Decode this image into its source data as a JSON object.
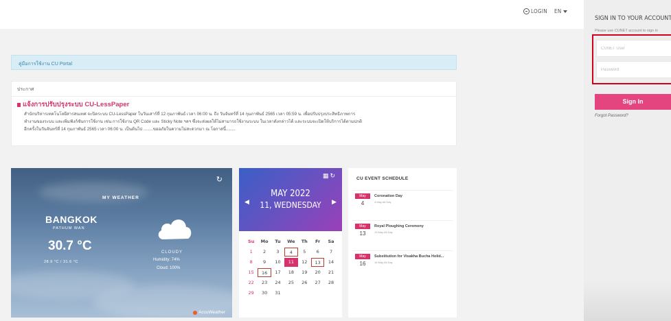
{
  "topnav": {
    "login": "LOGIN",
    "lang": "EN"
  },
  "manual_link": "คู่มือการใช้งาน CU Portal",
  "announcement": {
    "heading": "ประกาศ",
    "title": "แจ้งการปรับปรุงระบบ CU-LessPaper",
    "lines": [
      "สำนักบริหารเทคโนโลยีสารสนเทศ จะปิดระบบ CU-LessPaper ในวันเสาร์ที่ 12 กุมภาพันธ์ เวลา 06:00 น. ถึง วันจันทร์ที่ 14 กุมภาพันธ์ 2565 เวลา 05:59 น. เพื่อปรับปรุงประสิทธิภาพการ",
      "ทำงานของระบบ และเพิ่มฟังก์ชันการใช้งาน เช่น การใช้งาน QR Code และ Sticky Note ฯลฯ ซึ่งจะส่งผลให้ไม่สามารถใช้งานระบบ ในเวลาดังกล่าวได้ และระบบจะเปิดให้บริการได้ตามปกติ",
      "อีกครั้งในวันจันทร์ที่ 14 กุมภาพันธ์ 2565 เวลา 06:00 น. เป็นต้นไป ........ขออภัยในความไม่สะดวกมา ณ โอกาสนี้........"
    ]
  },
  "weather": {
    "title": "MY WEATHER",
    "city": "BANGKOK",
    "district": "PATHUM WAN",
    "temp": "30.7 °C",
    "range": "28.9 °C / 31.6 °C",
    "condition": "CLOUDY",
    "humidity": "Humidity: 74%",
    "cloud": "Cloud: 100%",
    "provider": "AccuWeather"
  },
  "calendar": {
    "month": "MAY 2022",
    "day": "11, WEDNESDAY",
    "weekdays": [
      "Su",
      "Mo",
      "Tu",
      "We",
      "Th",
      "Fr",
      "Sa"
    ],
    "weeks": [
      [
        "1",
        "2",
        "3",
        "4",
        "5",
        "6",
        "7"
      ],
      [
        "8",
        "9",
        "10",
        "11",
        "12",
        "13",
        "14"
      ],
      [
        "15",
        "16",
        "17",
        "18",
        "19",
        "20",
        "21"
      ],
      [
        "22",
        "23",
        "24",
        "25",
        "26",
        "27",
        "28"
      ],
      [
        "29",
        "30",
        "31",
        "",
        "",
        "",
        ""
      ]
    ],
    "today": "11",
    "event_days": [
      "4",
      "13",
      "16"
    ]
  },
  "events": {
    "title": "CU EVENT SCHEDULE",
    "items": [
      {
        "month": "May",
        "day": "4",
        "name": "Coronation Day",
        "sub": "4 May All Day"
      },
      {
        "month": "May",
        "day": "13",
        "name": "Royal Ploughing Ceremony",
        "sub": "13 May All Day"
      },
      {
        "month": "May",
        "day": "16",
        "name": "Substitution for Visakha Bucha Holid...",
        "sub": "16 May All Day"
      }
    ]
  },
  "signin": {
    "title": "SIGN IN TO YOUR ACCOUNT",
    "hint": "Please use CUNET account to sign in",
    "user_placeholder": "CUNET User",
    "password_placeholder": "Password",
    "button": "Sign In",
    "forgot": "Forgot Password?"
  },
  "colors": {
    "accent": "#e5457f",
    "info_bg": "#d9edf7",
    "highlight_box": "#d0021b"
  }
}
